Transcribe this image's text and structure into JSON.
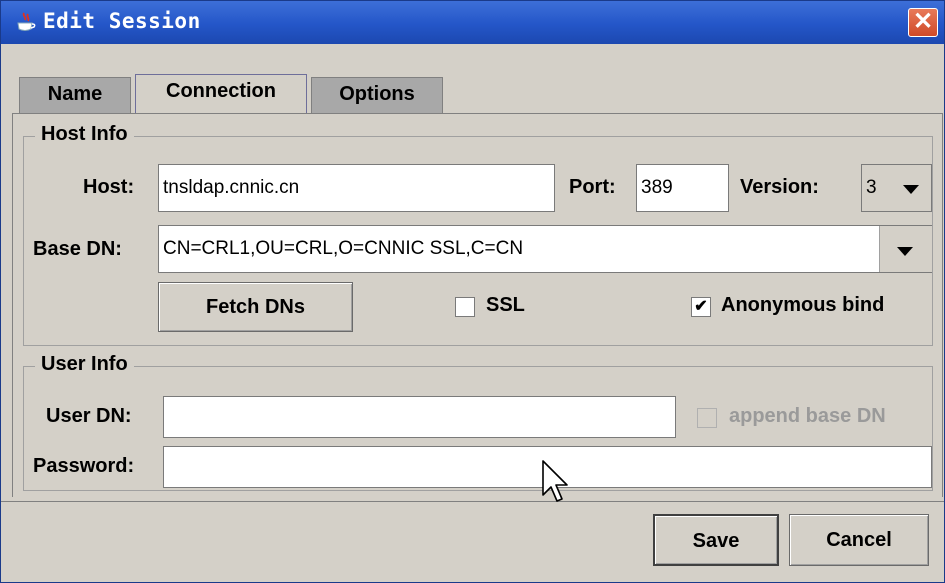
{
  "window": {
    "title": "Edit Session"
  },
  "tabs": [
    {
      "label": "Name",
      "active": false
    },
    {
      "label": "Connection",
      "active": true
    },
    {
      "label": "Options",
      "active": false
    }
  ],
  "host_info": {
    "title": "Host Info",
    "host_label": "Host:",
    "host_value": "tnsldap.cnnic.cn",
    "port_label": "Port:",
    "port_value": "389",
    "version_label": "Version:",
    "version_value": "3",
    "base_dn_label": "Base DN:",
    "base_dn_value": "CN=CRL1,OU=CRL,O=CNNIC SSL,C=CN",
    "fetch_button": "Fetch DNs",
    "ssl_label": "SSL",
    "ssl_checked": false,
    "anonymous_label": "Anonymous bind",
    "anonymous_checked": true,
    "check_mark": "✔"
  },
  "user_info": {
    "title": "User Info",
    "user_dn_label": "User DN:",
    "user_dn_value": "",
    "append_label": "append base DN",
    "append_checked": false,
    "password_label": "Password:",
    "password_value": ""
  },
  "buttons": {
    "save": "Save",
    "cancel": "Cancel"
  },
  "colors": {
    "titlebar": "#2456c8",
    "dialog_bg": "#d4d0c8",
    "close": "#d04a28"
  }
}
